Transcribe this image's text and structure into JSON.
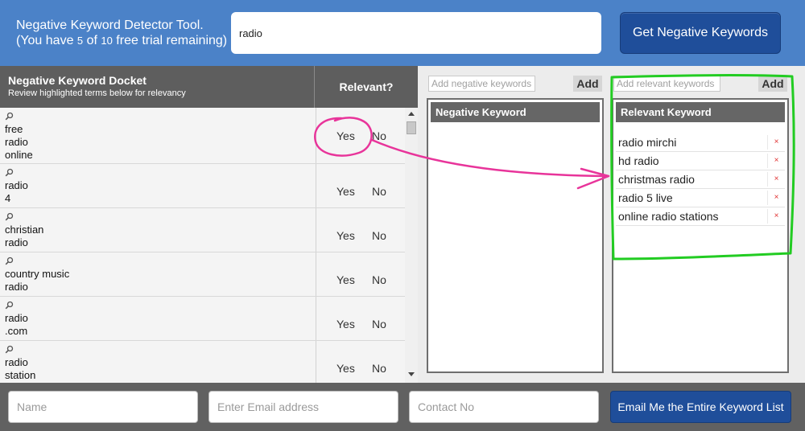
{
  "header": {
    "title_line1": "Negative Keyword Detector Tool.",
    "title_line2_prefix": "(You have ",
    "title_used": "5",
    "title_of": " of ",
    "title_total": "10",
    "title_line2_suffix": " free trial remaining)",
    "search_value": "radio",
    "get_button_label": "Get Negative Keywords"
  },
  "docket": {
    "title": "Negative Keyword Docket",
    "subtitle": "Review highlighted terms below for relevancy",
    "relevant_header": "Relevant?",
    "yes_label": "Yes",
    "no_label": "No",
    "rows": [
      {
        "term": "free\nradio\nonline"
      },
      {
        "term": "radio\n4"
      },
      {
        "term": "christian\nradio"
      },
      {
        "term": "country music\nradio"
      },
      {
        "term": "radio\n.com"
      },
      {
        "term": "radio\nstation"
      }
    ]
  },
  "negative_panel": {
    "add_placeholder": "Add negative keywords",
    "add_label": "Add",
    "header": "Negative Keyword"
  },
  "relevant_panel": {
    "add_placeholder": "Add relevant keywords",
    "add_label": "Add",
    "header": "Relevant Keyword",
    "remove_symbol": "×",
    "keywords": [
      "radio mirchi",
      "hd radio",
      "christmas radio",
      "radio 5 live",
      "online radio stations"
    ]
  },
  "footer": {
    "name_placeholder": "Name",
    "email_placeholder": "Enter Email address",
    "contact_placeholder": "Contact No",
    "email_button_label": "Email Me the Entire Keyword List"
  },
  "colors": {
    "header_bg": "#4b82c8",
    "button_bg": "#1f4e9a",
    "annotation_pink": "#e8349a",
    "annotation_green": "#22cc22"
  }
}
